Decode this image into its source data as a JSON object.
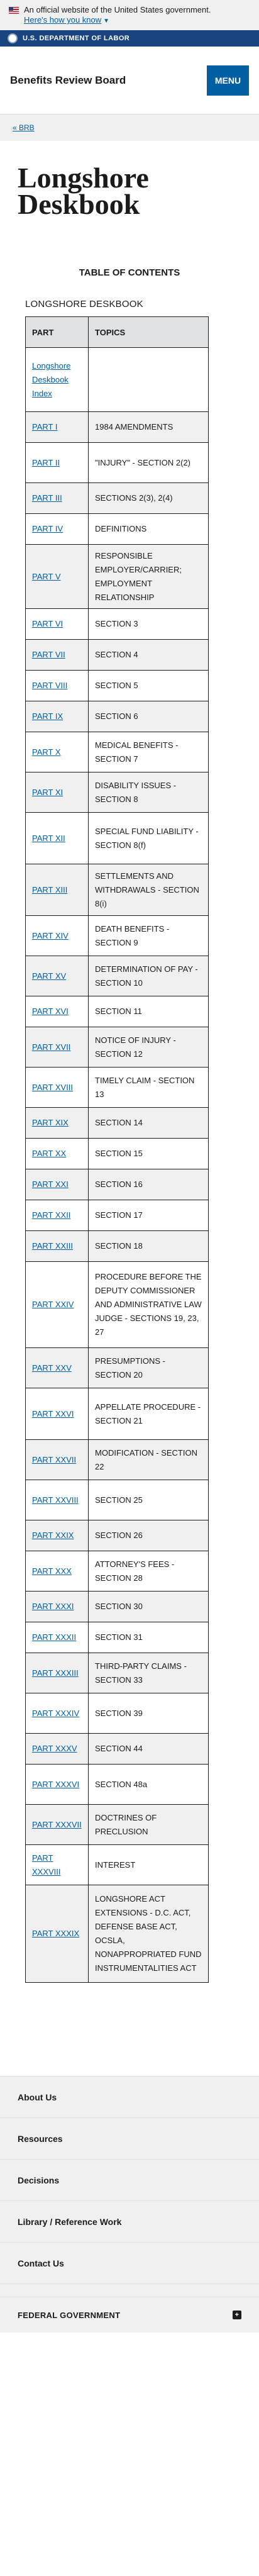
{
  "gov_banner": {
    "text": "An official website of the United States government.",
    "link": "Here's how you know"
  },
  "agency_bar": {
    "label": "U.S. DEPARTMENT OF LABOR"
  },
  "header": {
    "title": "Benefits Review Board",
    "menu_label": "MENU"
  },
  "breadcrumb": {
    "back_label": "« BRB"
  },
  "page": {
    "title_line1": "Longshore",
    "title_line2": "Deskbook",
    "toc_heading": "TABLE OF CONTENTS",
    "toc_subheading": "LONGSHORE DESKBOOK"
  },
  "toc": {
    "col_part": "PART",
    "col_topics": "TOPICS",
    "rows": [
      {
        "part": "Longshore Deskbook Index",
        "topic": ""
      },
      {
        "part": "PART I",
        "topic": "1984 AMENDMENTS"
      },
      {
        "part": "PART II",
        "topic": "\"INJURY\" - SECTION 2(2)"
      },
      {
        "part": "PART III",
        "topic": "SECTIONS 2(3), 2(4)"
      },
      {
        "part": "PART IV",
        "topic": "DEFINITIONS"
      },
      {
        "part": "PART V",
        "topic": "RESPONSIBLE EMPLOYER/CARRIER; EMPLOYMENT RELATIONSHIP"
      },
      {
        "part": "PART VI",
        "topic": "SECTION 3"
      },
      {
        "part": "PART VII",
        "topic": "SECTION 4"
      },
      {
        "part": "PART VIII",
        "topic": "SECTION 5"
      },
      {
        "part": "PART IX",
        "topic": "SECTION 6"
      },
      {
        "part": "PART X",
        "topic": "MEDICAL BENEFITS - SECTION 7"
      },
      {
        "part": "PART XI",
        "topic": "DISABILITY ISSUES - SECTION 8"
      },
      {
        "part": "PART XII",
        "topic": "SPECIAL FUND LIABILITY - SECTION 8(f)"
      },
      {
        "part": "PART XIII",
        "topic": "SETTLEMENTS AND WITHDRAWALS - SECTION 8(i)"
      },
      {
        "part": "PART XIV",
        "topic": "DEATH BENEFITS - SECTION 9"
      },
      {
        "part": "PART XV",
        "topic": "DETERMINATION OF PAY - SECTION 10"
      },
      {
        "part": "PART XVI",
        "topic": "SECTION 11"
      },
      {
        "part": "PART XVII",
        "topic": "NOTICE OF INJURY - SECTION 12"
      },
      {
        "part": "PART XVIII",
        "topic": "TIMELY CLAIM - SECTION 13"
      },
      {
        "part": "PART XIX",
        "topic": "SECTION 14"
      },
      {
        "part": "PART XX",
        "topic": "SECTION 15"
      },
      {
        "part": "PART XXI",
        "topic": "SECTION 16"
      },
      {
        "part": "PART XXII",
        "topic": "SECTION 17"
      },
      {
        "part": "PART XXIII",
        "topic": "SECTION 18"
      },
      {
        "part": "PART XXIV",
        "topic": "PROCEDURE BEFORE THE DEPUTY COMMISSIONER AND ADMINISTRATIVE LAW JUDGE - SECTIONS 19, 23, 27"
      },
      {
        "part": "PART XXV",
        "topic": "PRESUMPTIONS - SECTION 20"
      },
      {
        "part": "PART XXVI",
        "topic": "APPELLATE PROCEDURE - SECTION 21"
      },
      {
        "part": "PART XXVII",
        "topic": "MODIFICATION - SECTION 22"
      },
      {
        "part": "PART XXVIII",
        "topic": "SECTION 25"
      },
      {
        "part": "PART XXIX",
        "topic": "SECTION 26"
      },
      {
        "part": "PART XXX",
        "topic": "ATTORNEY'S FEES - SECTION 28"
      },
      {
        "part": "PART XXXI",
        "topic": "SECTION 30"
      },
      {
        "part": "PART XXXII",
        "topic": "SECTION 31"
      },
      {
        "part": "PART XXXIII",
        "topic": "THIRD-PARTY CLAIMS - SECTION 33"
      },
      {
        "part": "PART XXXIV",
        "topic": "SECTION 39"
      },
      {
        "part": "PART XXXV",
        "topic": "SECTION 44"
      },
      {
        "part": "PART XXXVI",
        "topic": "SECTION 48a"
      },
      {
        "part": "PART XXXVII",
        "topic": "DOCTRINES OF PRECLUSION"
      },
      {
        "part": "PART XXXVIII",
        "topic": "INTEREST"
      },
      {
        "part": "PART XXXIX",
        "topic": "LONGSHORE ACT EXTENSIONS - D.C. ACT, DEFENSE BASE ACT, OCSLA, NONAPPROPRIATED FUND INSTRUMENTALITIES ACT"
      }
    ]
  },
  "footer": {
    "links": [
      "About Us",
      "Resources",
      "Decisions",
      "Library / Reference Work",
      "Contact Us"
    ],
    "federal_label": "FEDERAL GOVERNMENT",
    "expand_icon": "plus-icon"
  }
}
